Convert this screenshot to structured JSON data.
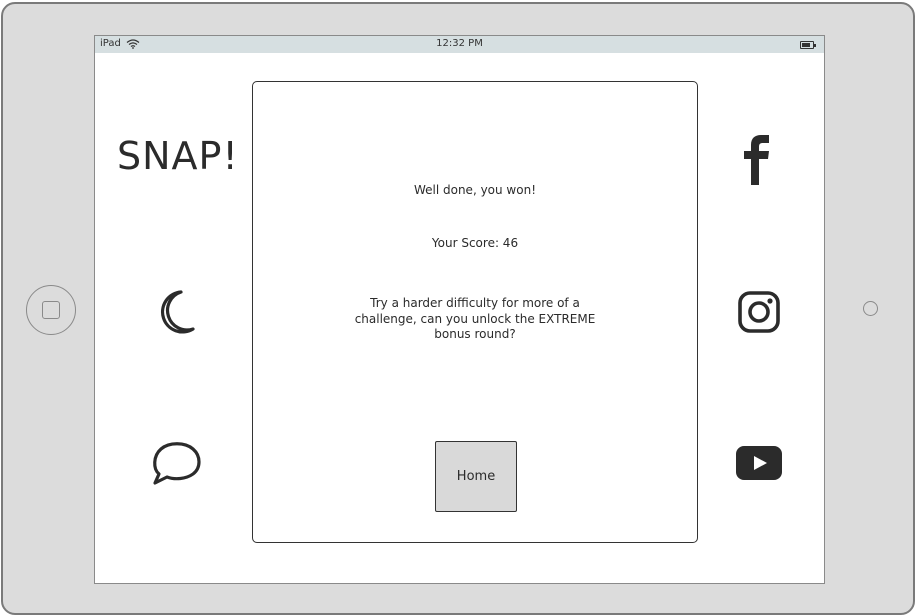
{
  "status_bar": {
    "device": "iPad",
    "time": "12:32 PM"
  },
  "app": {
    "title": "SNAP!"
  },
  "dialog": {
    "headline": "Well done, you won!",
    "score": "Your Score: 46",
    "message": "Try a harder difficulty for more of a challenge, can you unlock the EXTREME bonus round?",
    "home_label": "Home"
  },
  "icons": {
    "left": [
      "moon-icon",
      "chat-bubble-icon"
    ],
    "right": [
      "facebook-icon",
      "instagram-icon",
      "youtube-icon"
    ]
  },
  "colors": {
    "status_bar": "#d6dfe1",
    "icon": "#2b2b2b",
    "button": "#d9d9d9",
    "device_frame": "#dcdcdc"
  }
}
